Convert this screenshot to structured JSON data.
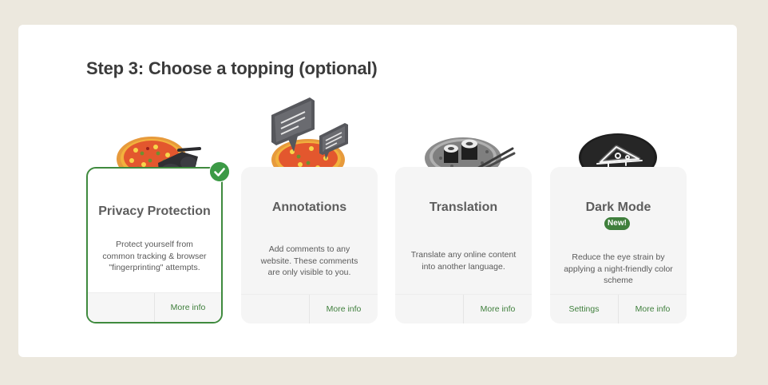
{
  "step_title": "Step 3: Choose a topping (optional)",
  "cards": [
    {
      "name": "Privacy Protection",
      "description": "Protect yourself from common tracking & browser \"fingerprinting\" attempts.",
      "footer_right": "More info",
      "selected": true,
      "art_icon": "pizza-with-sunglasses-icon"
    },
    {
      "name": "Annotations",
      "description": "Add comments to any website. These comments are only visible to you.",
      "footer_right": "More info",
      "art_icon": "pizza-with-speech-bubbles-icon"
    },
    {
      "name": "Translation",
      "description": "Translate any online content into another language.",
      "footer_right": "More info",
      "art_icon": "sushi-plate-icon"
    },
    {
      "name": "Dark Mode",
      "badge": "New!",
      "description": "Reduce the eye strain by applying a night-friendly color scheme",
      "footer_left": "Settings",
      "footer_right": "More info",
      "art_icon": "neon-pizza-slice-icon"
    }
  ],
  "colors": {
    "background": "#ece8de",
    "accent_green": "#3f8a3e",
    "card_bg": "#f5f5f5"
  }
}
